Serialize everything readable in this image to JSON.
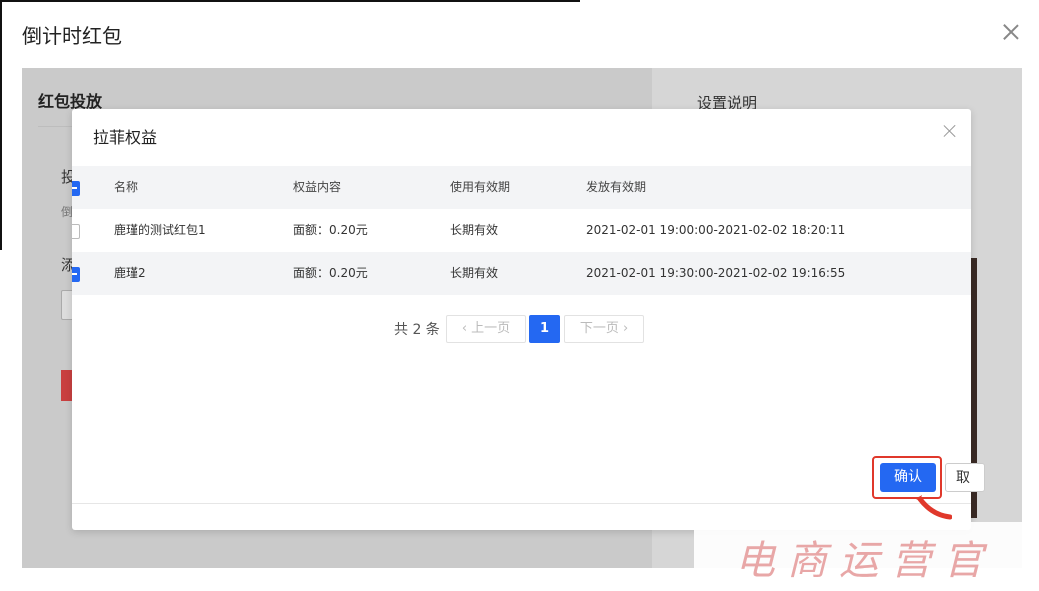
{
  "outer": {
    "title": "倒计时红包",
    "left_section_title": "红包投放",
    "right_section_title": "设置说明",
    "ghost_labels": [
      "投",
      "倒",
      "添"
    ]
  },
  "modal": {
    "title": "拉菲权益",
    "columns": [
      "名称",
      "权益内容",
      "使用有效期",
      "发放有效期"
    ],
    "rows": [
      {
        "name": "鹿瑾的测试红包1",
        "content": "面额：0.20元",
        "validity": "长期有效",
        "period": "2021-02-01 19:00:00-2021-02-02 18:20:11",
        "checked": false
      },
      {
        "name": "鹿瑾2",
        "content": "面额：0.20元",
        "validity": "长期有效",
        "period": "2021-02-01 19:30:00-2021-02-02 19:16:55",
        "checked": true
      }
    ],
    "pagination": {
      "total_label": "共 2 条",
      "prev_label": "上一页",
      "next_label": "下一页",
      "current_page": "1"
    }
  },
  "footer": {
    "confirm_label": "确认",
    "cancel_label": "取"
  },
  "watermark": "电商运营官",
  "colors": {
    "primary": "#2468f2",
    "highlight": "#e0382b"
  }
}
